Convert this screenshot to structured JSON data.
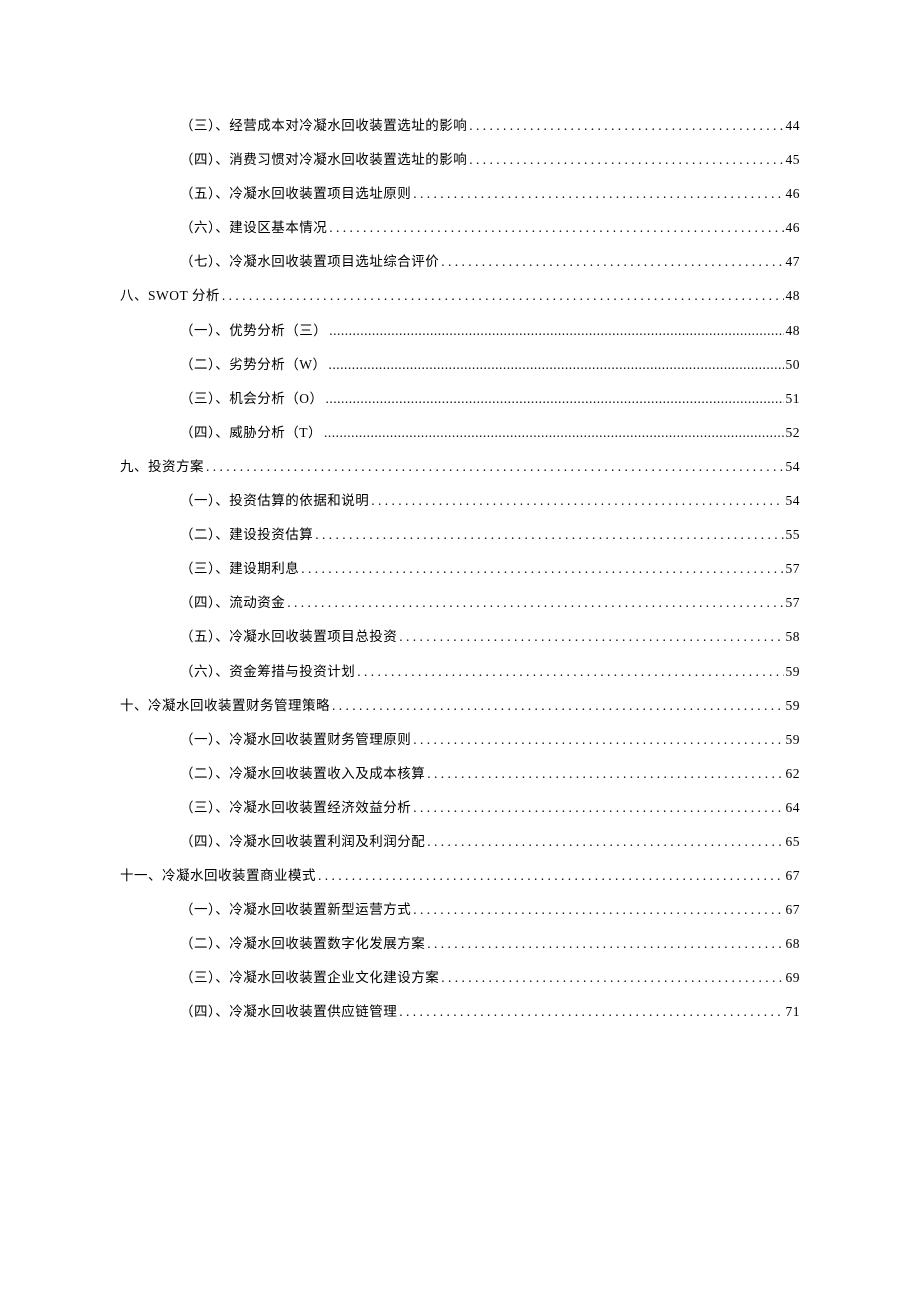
{
  "toc": [
    {
      "level": "sub",
      "label": "（三）、经营成本对冷凝水回收装置选址的影响",
      "dots": "spaced",
      "page": "44"
    },
    {
      "level": "sub",
      "label": "（四）、消费习惯对冷凝水回收装置选址的影响",
      "dots": "spaced",
      "page": "45"
    },
    {
      "level": "sub",
      "label": "（五）、冷凝水回收装置项目选址原则",
      "dots": "spaced",
      "page": "46"
    },
    {
      "level": "sub",
      "label": "（六）、建设区基本情况",
      "dots": "spaced",
      "page": "46"
    },
    {
      "level": "sub",
      "label": "（七）、冷凝水回收装置项目选址综合评价",
      "dots": "spaced",
      "page": "47"
    },
    {
      "level": "section",
      "label": "八、SWOT 分析",
      "dots": "spaced",
      "page": "48"
    },
    {
      "level": "sub",
      "label": "（一）、优势分析（三）",
      "dots": "tight",
      "page": "48"
    },
    {
      "level": "sub",
      "label": "（二）、劣势分析（W）",
      "dots": "tight",
      "page": "50"
    },
    {
      "level": "sub",
      "label": "（三）、机会分析（O）",
      "dots": "tight",
      "page": "51"
    },
    {
      "level": "sub",
      "label": "（四）、威胁分析（T）",
      "dots": "tight",
      "page": "52"
    },
    {
      "level": "section",
      "label": "九、投资方案",
      "dots": "spaced",
      "page": "54"
    },
    {
      "level": "sub",
      "label": "（一）、投资估算的依据和说明",
      "dots": "spaced",
      "page": "54"
    },
    {
      "level": "sub",
      "label": "（二）、建设投资估算",
      "dots": "spaced",
      "page": "55"
    },
    {
      "level": "sub",
      "label": "（三）、建设期利息",
      "dots": "spaced",
      "page": "57"
    },
    {
      "level": "sub",
      "label": "（四）、流动资金",
      "dots": "spaced",
      "page": "57"
    },
    {
      "level": "sub",
      "label": "（五）、冷凝水回收装置项目总投资",
      "dots": "spaced",
      "page": "58"
    },
    {
      "level": "sub",
      "label": "（六）、资金筹措与投资计划",
      "dots": "spaced",
      "page": "59"
    },
    {
      "level": "section",
      "label": "十、冷凝水回收装置财务管理策略",
      "dots": "spaced",
      "page": "59"
    },
    {
      "level": "sub",
      "label": "（一）、冷凝水回收装置财务管理原则",
      "dots": "spaced",
      "page": "59"
    },
    {
      "level": "sub",
      "label": "（二）、冷凝水回收装置收入及成本核算",
      "dots": "spaced",
      "page": "62"
    },
    {
      "level": "sub",
      "label": "（三）、冷凝水回收装置经济效益分析",
      "dots": "spaced",
      "page": "64"
    },
    {
      "level": "sub",
      "label": "（四）、冷凝水回收装置利润及利润分配",
      "dots": "spaced",
      "page": "65"
    },
    {
      "level": "section",
      "label": "十一、冷凝水回收装置商业模式",
      "dots": "spaced",
      "page": "67"
    },
    {
      "level": "sub",
      "label": "（一）、冷凝水回收装置新型运营方式",
      "dots": "spaced",
      "page": "67"
    },
    {
      "level": "sub",
      "label": "（二）、冷凝水回收装置数字化发展方案",
      "dots": "spaced",
      "page": "68"
    },
    {
      "level": "sub",
      "label": "（三）、冷凝水回收装置企业文化建设方案",
      "dots": "spaced",
      "page": "69"
    },
    {
      "level": "sub",
      "label": "（四）、冷凝水回收装置供应链管理",
      "dots": "spaced",
      "page": "71"
    }
  ]
}
